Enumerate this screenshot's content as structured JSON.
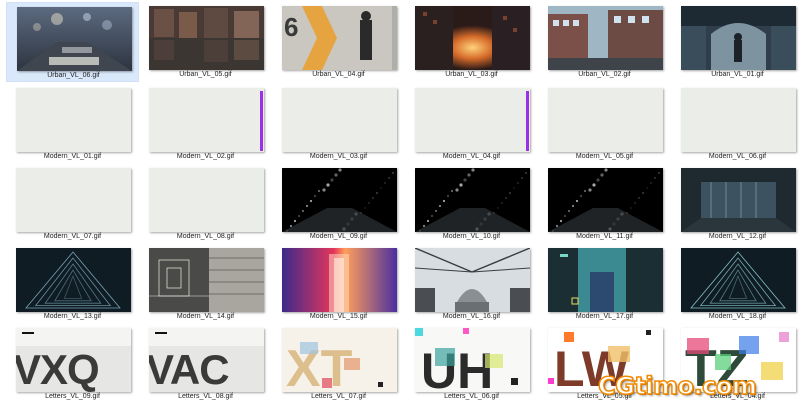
{
  "files": [
    {
      "name": "Urban_VL_06.gif",
      "selected": true,
      "thumb": "street-lamp-bokeh"
    },
    {
      "name": "Urban_VL_05.gif",
      "thumb": "wet-street-reflection"
    },
    {
      "name": "Urban_VL_04.gif",
      "thumb": "man-by-orange-arrow-wall"
    },
    {
      "name": "Urban_VL_03.gif",
      "thumb": "sunset-between-buildings"
    },
    {
      "name": "Urban_VL_02.gif",
      "thumb": "city-street-buildings"
    },
    {
      "name": "Urban_VL_01.gif",
      "thumb": "person-in-arched-passage"
    },
    {
      "name": "Modern_VL_01.gif",
      "thumb": "blank-light"
    },
    {
      "name": "Modern_VL_02.gif",
      "thumb": "blank-light-purple-bar"
    },
    {
      "name": "Modern_VL_03.gif",
      "thumb": "blank-light"
    },
    {
      "name": "Modern_VL_04.gif",
      "thumb": "blank-light-purple-bar"
    },
    {
      "name": "Modern_VL_05.gif",
      "thumb": "blank-light"
    },
    {
      "name": "Modern_VL_06.gif",
      "thumb": "blank-light"
    },
    {
      "name": "Modern_VL_07.gif",
      "thumb": "blank-light"
    },
    {
      "name": "Modern_VL_08.gif",
      "thumb": "blank-light"
    },
    {
      "name": "Modern_VL_09.gif",
      "thumb": "dark-bokeh-particles"
    },
    {
      "name": "Modern_VL_10.gif",
      "thumb": "dark-bokeh-particles"
    },
    {
      "name": "Modern_VL_11.gif",
      "thumb": "dark-bokeh-particles"
    },
    {
      "name": "Modern_VL_12.gif",
      "thumb": "dark-corridor"
    },
    {
      "name": "Modern_VL_13.gif",
      "thumb": "dark-triangle-tunnel"
    },
    {
      "name": "Modern_VL_14.gif",
      "thumb": "building-wireframe"
    },
    {
      "name": "Modern_VL_15.gif",
      "thumb": "neon-doorway"
    },
    {
      "name": "Modern_VL_16.gif",
      "thumb": "glass-dome-architecture"
    },
    {
      "name": "Modern_VL_17.gif",
      "thumb": "person-teal-shirt"
    },
    {
      "name": "Modern_VL_18.gif",
      "thumb": "dark-triangle-tunnel-teal"
    },
    {
      "name": "Letters_VL_09.gif",
      "thumb": "letters-vxq",
      "letters": "VXQ"
    },
    {
      "name": "Letters_VL_08.gif",
      "thumb": "letters-vac",
      "letters": "VAC"
    },
    {
      "name": "Letters_VL_07.gif",
      "thumb": "letters-xt",
      "letters": "XT"
    },
    {
      "name": "Letters_VL_06.gif",
      "thumb": "letters-uh",
      "letters": "UH"
    },
    {
      "name": "Letters_VL_05.gif",
      "thumb": "letters-lw",
      "letters": "LW"
    },
    {
      "name": "Letters_VL_04.gif",
      "thumb": "letters-tz",
      "letters": "TZ"
    }
  ],
  "watermark": "CGtimo.com",
  "colors": {
    "selection": "#d9e8fb",
    "blank_thumb": "#eaede8",
    "purple_bar": "#9b30e8",
    "watermark_orange": "#f08a00"
  }
}
